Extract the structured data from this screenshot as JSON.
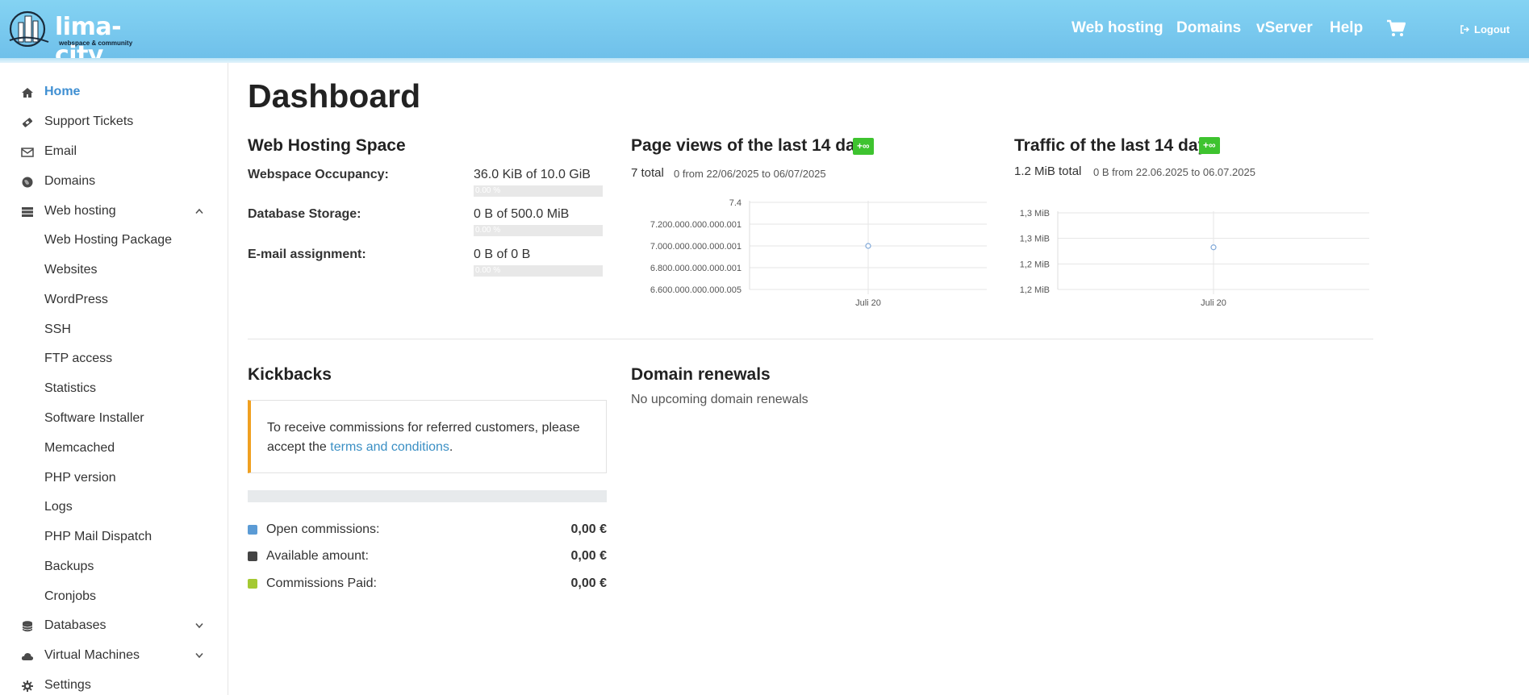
{
  "header": {
    "logo_title": "lima-city",
    "logo_subtitle": "webspace & community",
    "nav": [
      "Web hosting",
      "Domains",
      "vServer",
      "Help"
    ],
    "logout": "Logout"
  },
  "sidebar": {
    "items": [
      {
        "label": "Home",
        "icon": "home-icon",
        "active": true
      },
      {
        "label": "Support Tickets",
        "icon": "ticket-icon"
      },
      {
        "label": "Email",
        "icon": "envelope-icon"
      },
      {
        "label": "Domains",
        "icon": "globe-icon"
      },
      {
        "label": "Web hosting",
        "icon": "server-icon",
        "expanded": true
      },
      {
        "label": "Databases",
        "icon": "database-icon"
      },
      {
        "label": "Virtual Machines",
        "icon": "cloud-icon"
      },
      {
        "label": "Settings",
        "icon": "gear-icon"
      }
    ],
    "web_hosting_children": [
      "Web Hosting Package",
      "Websites",
      "WordPress",
      "SSH",
      "FTP access",
      "Statistics",
      "Software Installer",
      "Memcached",
      "PHP version",
      "Logs",
      "PHP Mail Dispatch",
      "Backups",
      "Cronjobs"
    ]
  },
  "main": {
    "title": "Dashboard",
    "web_hosting_space": {
      "title": "Web Hosting Space",
      "rows": [
        {
          "label": "Webspace Occupancy:",
          "value": "36.0 KiB of 10.0 GiB",
          "bar_text": "0.00 %",
          "fraction": 0.0
        },
        {
          "label": "Database Storage:",
          "value": "0 B of 500.0 MiB",
          "bar_text": "0.00 %",
          "fraction": 0.0
        },
        {
          "label": "E-mail assignment:",
          "value": "0 B of 0 B",
          "bar_text": "0.00 %",
          "fraction": 0.0
        }
      ]
    },
    "page_views": {
      "title": "Page views of the last 14 days",
      "badge": "+∞",
      "total": "7 total",
      "range": "0 from 22/06/2025 to 06/07/2025"
    },
    "traffic": {
      "title": "Traffic of the last 14 days",
      "badge": "+∞",
      "total": "1.2 MiB total",
      "range": "0 B from 22.06.2025 to 06.07.2025"
    },
    "kickbacks": {
      "title": "Kickbacks",
      "text_before": "To receive commissions for referred customers, please accept the ",
      "link": "terms and conditions",
      "text_after": ".",
      "legend": [
        {
          "label": "Open commissions:",
          "value": "0,00 €",
          "color": "#5b9bd5"
        },
        {
          "label": "Available amount:",
          "value": "0,00 €",
          "color": "#444444"
        },
        {
          "label": "Commissions Paid:",
          "value": "0,00 €",
          "color": "#a4c932"
        }
      ]
    },
    "domain_renewals": {
      "title": "Domain renewals",
      "text": "No upcoming domain renewals"
    }
  },
  "chart_data": [
    {
      "type": "line",
      "x": [
        "Juli 20"
      ],
      "values": [
        7
      ],
      "ytick_labels": [
        "7.4",
        "7.200.000.000.000.001",
        "7.000.000.000.000.001",
        "6.800.000.000.000.001",
        "6.600.000.000.000.005"
      ],
      "ylim": [
        6.6,
        7.4
      ],
      "grid": true
    },
    {
      "type": "line",
      "x": [
        "Juli 20"
      ],
      "values": [
        1.2
      ],
      "ytick_labels": [
        "1,3 MiB",
        "1,3 MiB",
        "1,2 MiB",
        "1,2 MiB"
      ],
      "grid": true
    }
  ]
}
